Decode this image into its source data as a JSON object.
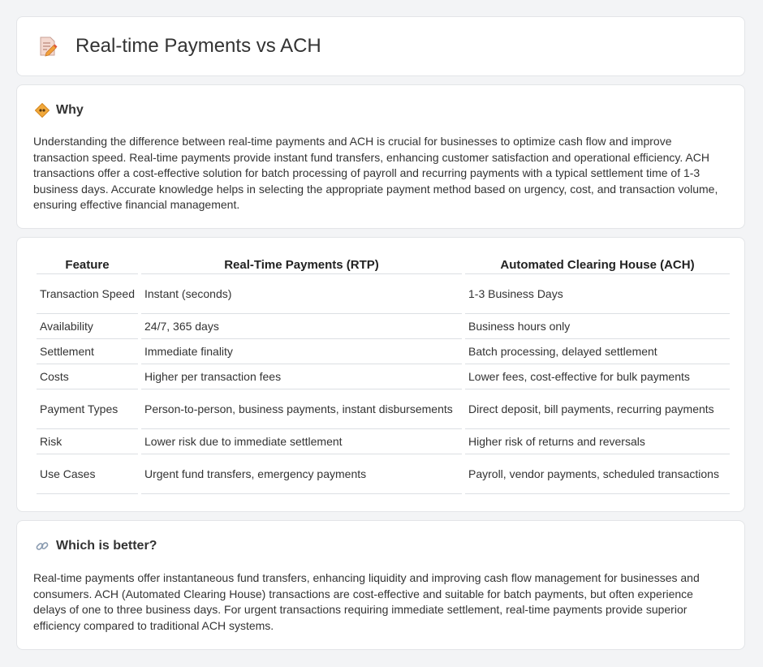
{
  "header": {
    "title": "Real-time Payments vs ACH"
  },
  "why": {
    "heading": "Why",
    "text": "Understanding the difference between real-time payments and ACH is crucial for businesses to optimize cash flow and improve transaction speed. Real-time payments provide instant fund transfers, enhancing customer satisfaction and operational efficiency. ACH transactions offer a cost-effective solution for batch processing of payroll and recurring payments with a typical settlement time of 1-3 business days. Accurate knowledge helps in selecting the appropriate payment method based on urgency, cost, and transaction volume, ensuring effective financial management."
  },
  "table": {
    "headers": [
      "Feature",
      "Real-Time Payments (RTP)",
      "Automated Clearing House (ACH)"
    ],
    "rows": [
      [
        "Transaction Speed",
        "Instant (seconds)",
        "1-3 Business Days"
      ],
      [
        "Availability",
        "24/7, 365 days",
        "Business hours only"
      ],
      [
        "Settlement",
        "Immediate finality",
        "Batch processing, delayed settlement"
      ],
      [
        "Costs",
        "Higher per transaction fees",
        "Lower fees, cost-effective for bulk payments"
      ],
      [
        "Payment Types",
        "Person-to-person, business payments, instant disbursements",
        "Direct deposit, bill payments, recurring payments"
      ],
      [
        "Risk",
        "Lower risk due to immediate settlement",
        "Higher risk of returns and reversals"
      ],
      [
        "Use Cases",
        "Urgent fund transfers, emergency payments",
        "Payroll, vendor payments, scheduled transactions"
      ]
    ]
  },
  "better": {
    "heading": "Which is better?",
    "text": "Real-time payments offer instantaneous fund transfers, enhancing liquidity and improving cash flow management for businesses and consumers. ACH (Automated Clearing House) transactions are cost-effective and suitable for batch payments, but often experience delays of one to three business days. For urgent transactions requiring immediate settlement, real-time payments provide superior efficiency compared to traditional ACH systems."
  }
}
